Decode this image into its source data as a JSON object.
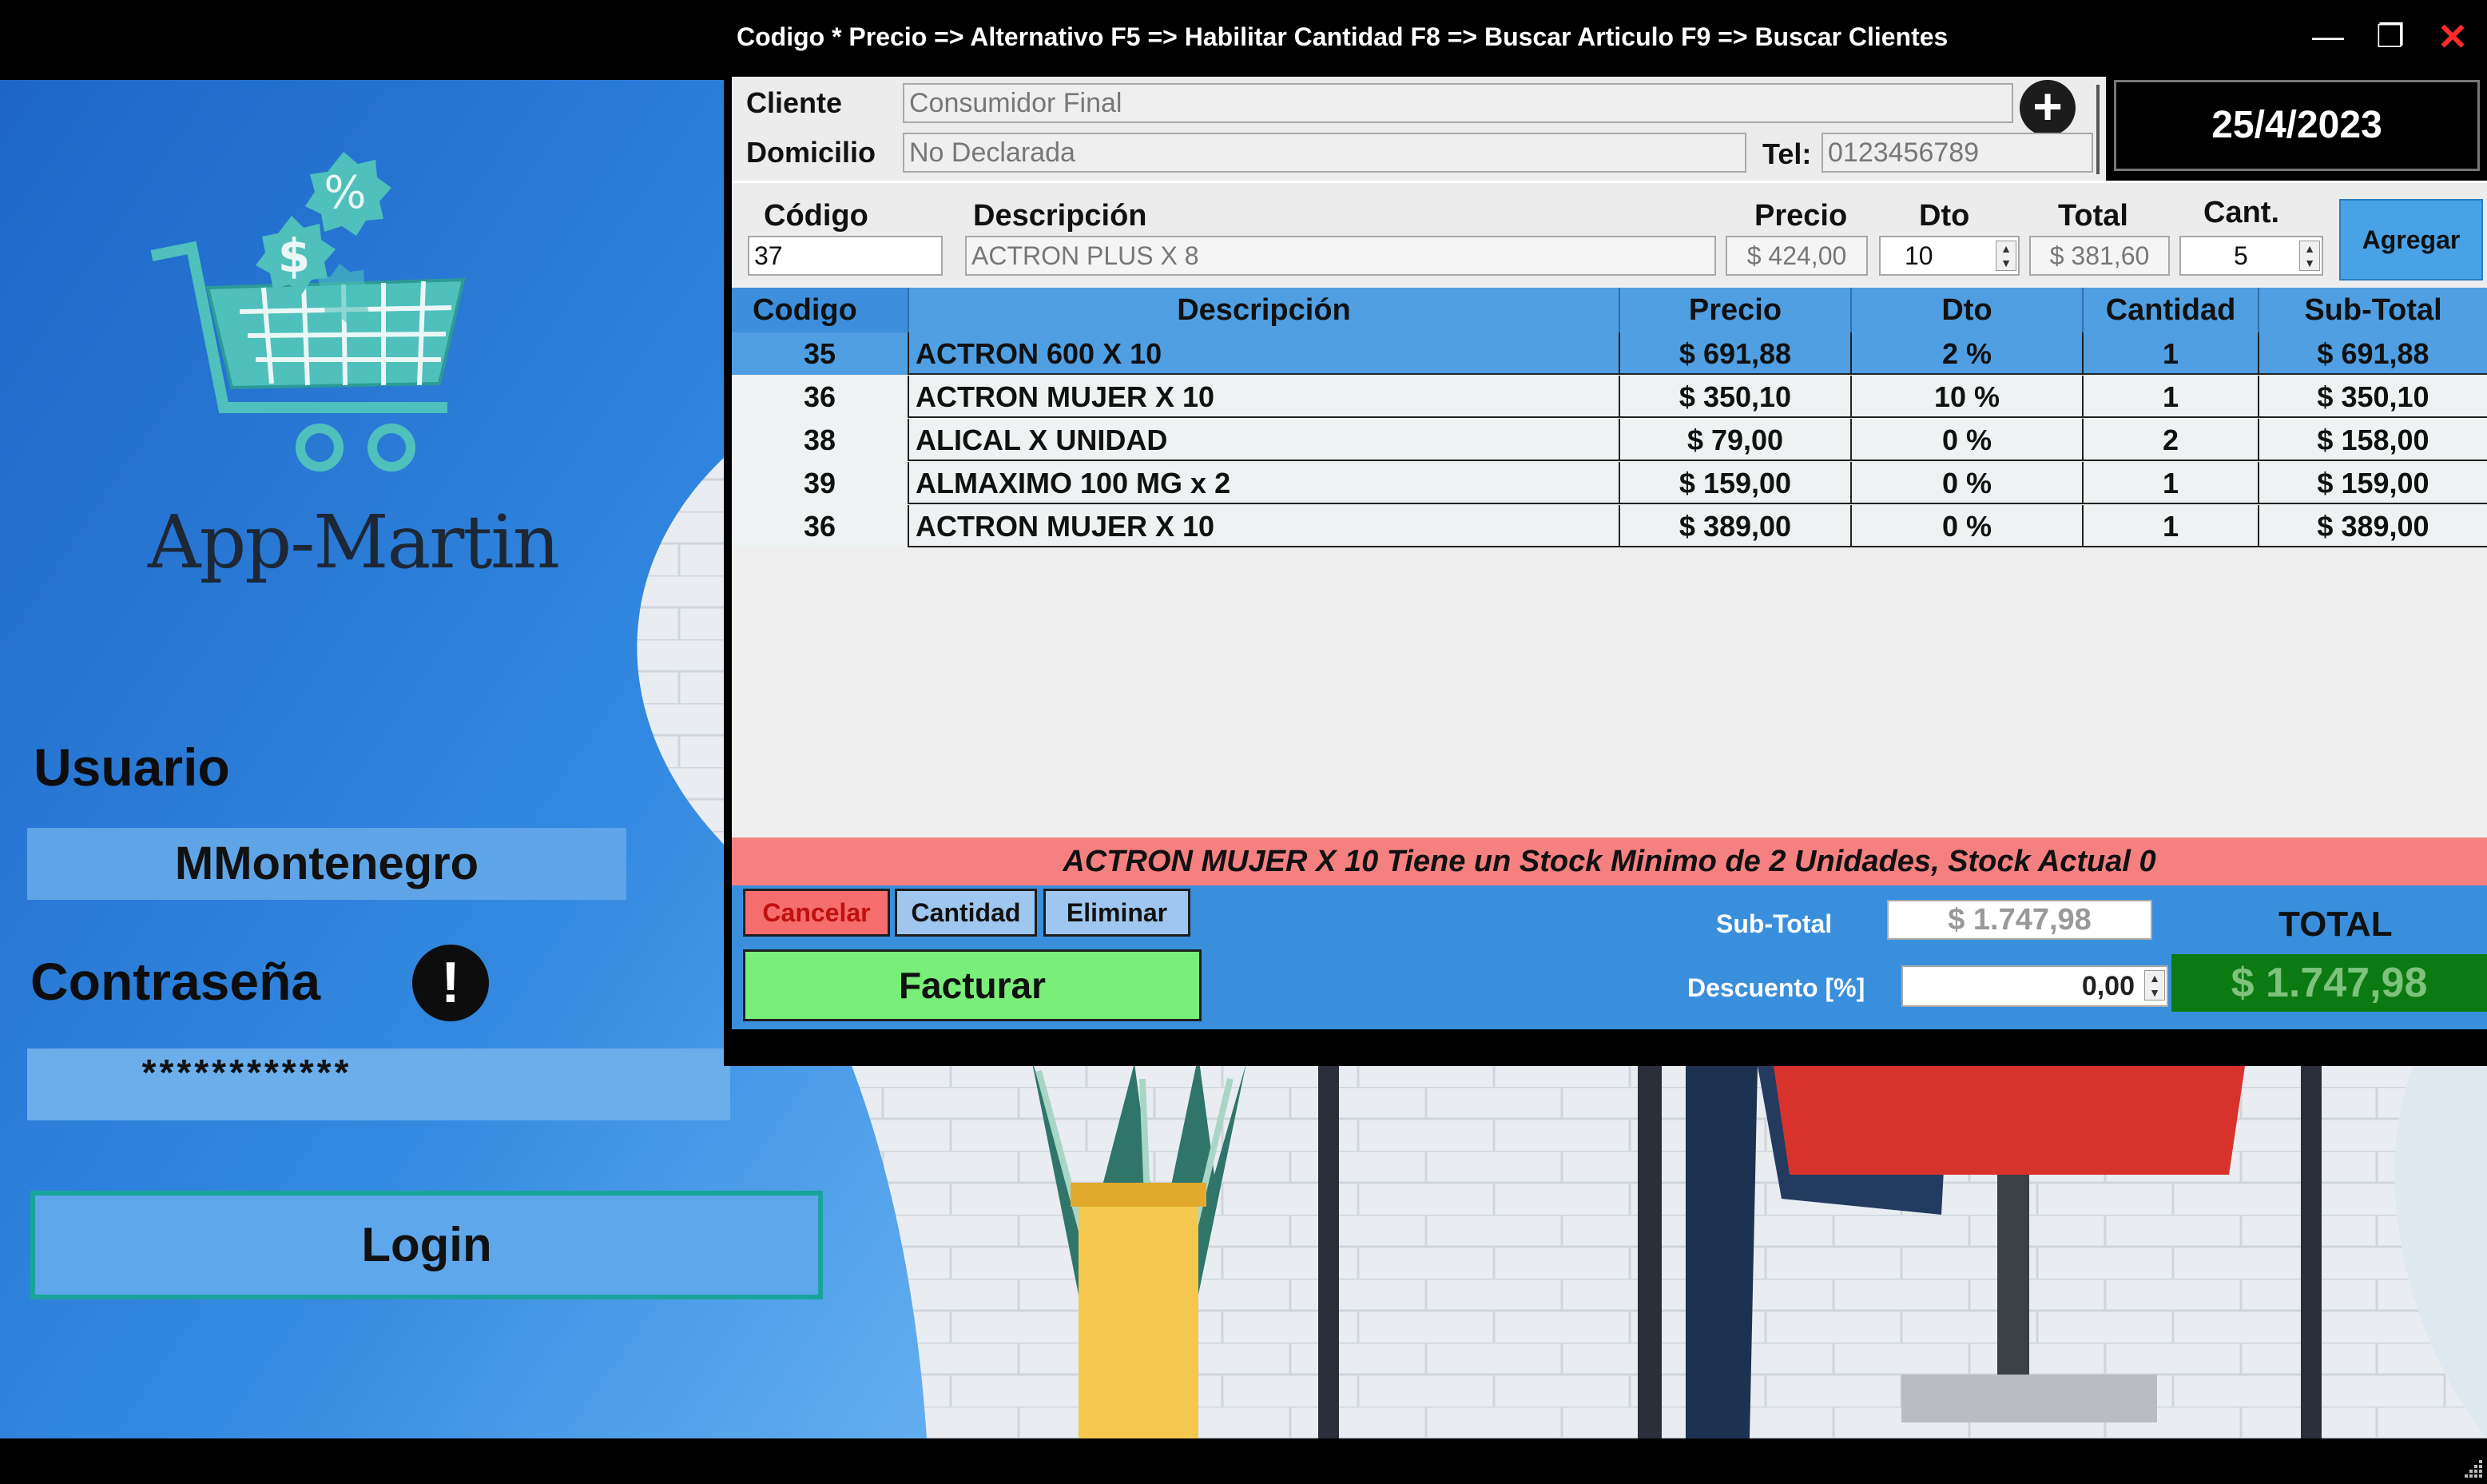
{
  "login": {
    "app_name": "App-Martin",
    "user_label": "Usuario",
    "user_value": "MMontenegro",
    "password_label": "Contraseña",
    "password_mask": "************",
    "login_button": "Login",
    "warn_symbol": "!"
  },
  "window": {
    "title": "Codigo  *  Precio => Alternativo  F5 => Habilitar Cantidad   F8 => Buscar Articulo   F9 => Buscar Clientes",
    "minimize": "—",
    "maximize": "❐",
    "close": "✕"
  },
  "client": {
    "cliente_label": "Cliente",
    "cliente_value": "Consumidor Final",
    "domicilio_label": "Domicilio",
    "domicilio_value": "No Declarada",
    "tel_label": "Tel:",
    "tel_value": "0123456789",
    "add_symbol": "+",
    "date": "25/4/2023"
  },
  "item_entry": {
    "codigo_label": "Código",
    "codigo_value": "37",
    "descripcion_label": "Descripción",
    "descripcion_value": "ACTRON PLUS X 8",
    "precio_label": "Precio",
    "precio_value": "$ 424,00",
    "dto_label": "Dto",
    "dto_value": "10",
    "total_label": "Total",
    "total_value": "$ 381,60",
    "cant_label": "Cant.",
    "cant_value": "5",
    "agregar_button": "Agregar"
  },
  "table": {
    "headers": [
      "Codigo",
      "Descripción",
      "Precio",
      "Dto",
      "Cantidad",
      "Sub-Total"
    ],
    "rows": [
      [
        "35",
        "ACTRON 600 X 10",
        "$ 691,88",
        "2 %",
        "1",
        "$ 691,88"
      ],
      [
        "36",
        "ACTRON MUJER X 10",
        "$ 350,10",
        "10 %",
        "1",
        "$ 350,10"
      ],
      [
        "38",
        "ALICAL X UNIDAD",
        "$ 79,00",
        "0 %",
        "2",
        "$ 158,00"
      ],
      [
        "39",
        "ALMAXIMO 100 MG x 2",
        "$ 159,00",
        "0 %",
        "1",
        "$ 159,00"
      ],
      [
        "36",
        "ACTRON MUJER X 10",
        "$ 389,00",
        "0 %",
        "1",
        "$ 389,00"
      ]
    ]
  },
  "alert": "ACTRON MUJER X 10 Tiene un Stock Minimo de 2 Unidades, Stock Actual 0",
  "footer": {
    "cancelar": "Cancelar",
    "cantidad": "Cantidad",
    "eliminar": "Eliminar",
    "facturar": "Facturar",
    "subtotal_label": "Sub-Total",
    "subtotal_value": "$ 1.747,98",
    "descuento_label": "Descuento [%]",
    "descuento_value": "0,00",
    "total_label": "TOTAL",
    "total_value": "$ 1.747,98"
  },
  "colors": {
    "header_blue": "#4f9fe2",
    "selected_row": "#4f9fe2",
    "alert_red": "#f58080",
    "facturar_green": "#79ef79",
    "total_green": "#0c7a12"
  },
  "icons": [
    "cart-icon",
    "percent-tag-icon",
    "dollar-tag-icon",
    "add-client-icon",
    "warning-icon",
    "minimize-icon",
    "maximize-icon",
    "close-icon",
    "spin-icon",
    "resize-grip-icon"
  ]
}
